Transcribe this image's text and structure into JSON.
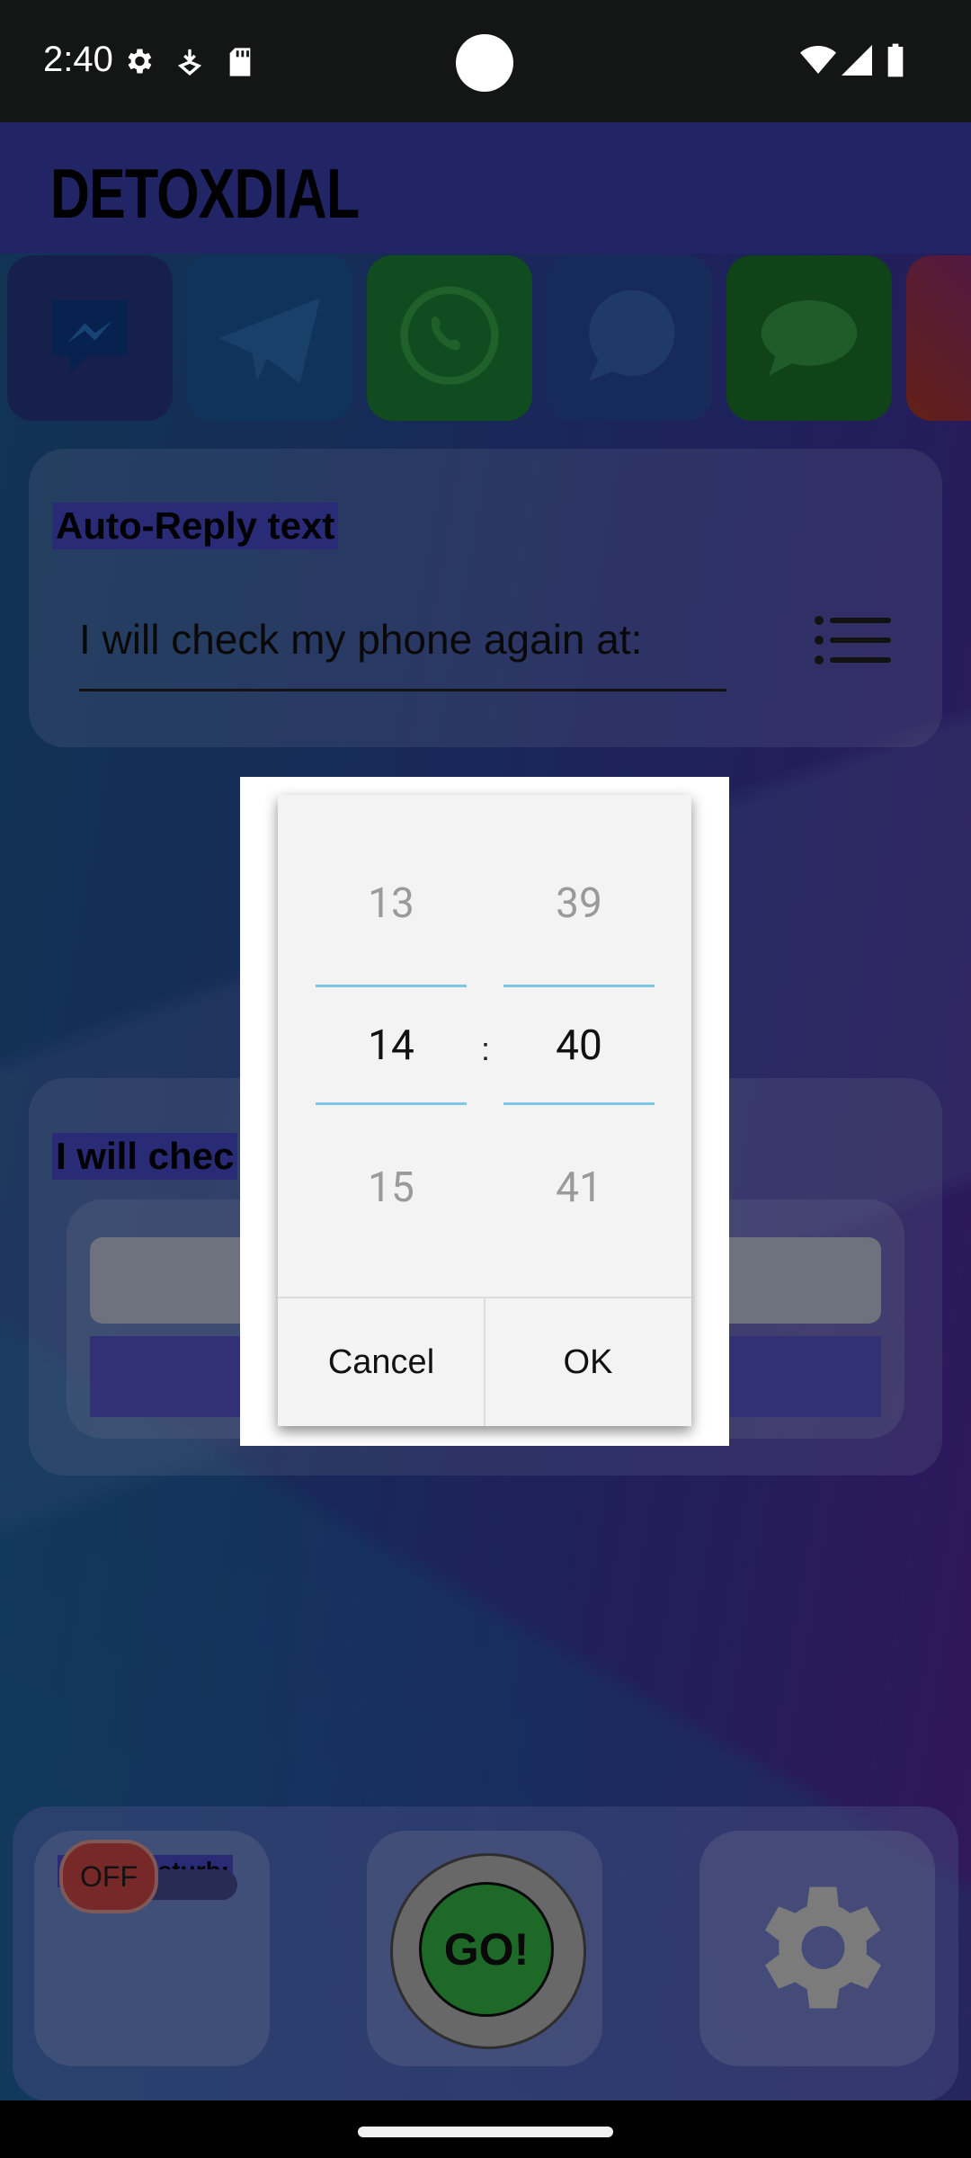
{
  "status_bar": {
    "time": "2:40",
    "icons": [
      "settings-icon",
      "download-icon",
      "sd-card-icon",
      "wifi-icon",
      "signal-icon",
      "battery-icon"
    ]
  },
  "app": {
    "title": "DETOXDIAL",
    "apps": [
      "messenger-icon",
      "telegram-icon",
      "whatsapp-icon",
      "signal-icon",
      "messages-icon",
      "instagram-icon"
    ],
    "auto_reply": {
      "label": "Auto-Reply text",
      "value": "I will check my phone again at:"
    },
    "check_card": {
      "label": "I will chec"
    },
    "bottom": {
      "dnd_label": "Don't-Disturb:",
      "dnd_toggle": "OFF",
      "go_label": "GO!"
    }
  },
  "time_picker": {
    "hour_prev": "13",
    "hour": "14",
    "hour_next": "15",
    "separator": ":",
    "minute_prev": "39",
    "minute": "40",
    "minute_next": "41",
    "cancel_label": "Cancel",
    "ok_label": "OK"
  },
  "colors": {
    "accent_line": "#7cc7e6",
    "header": "#3d44b8"
  }
}
